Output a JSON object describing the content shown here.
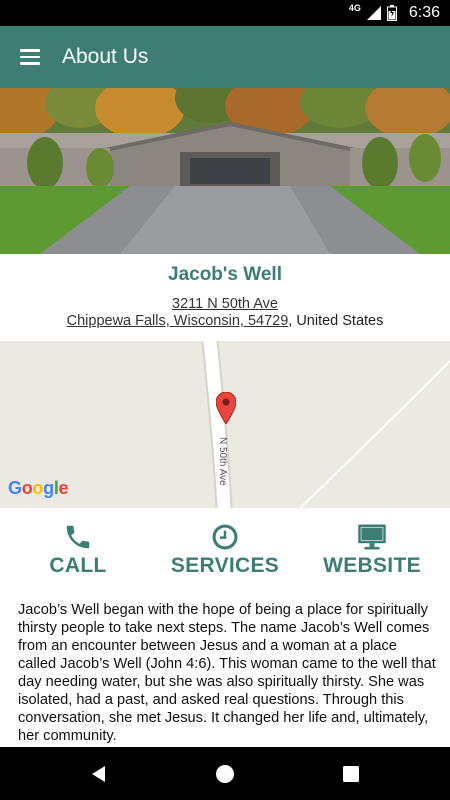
{
  "status_bar": {
    "network": "4G",
    "time": "6:36"
  },
  "app_bar": {
    "title": "About Us"
  },
  "organization": {
    "name": "Jacob's Well",
    "street": "3211 N 50th Ave",
    "city_state_zip": "Chippewa Falls, Wisconsin, 54729",
    "country_suffix": ", United States"
  },
  "map": {
    "road_label": "N 50th Ave",
    "attribution": [
      "G",
      "o",
      "o",
      "g",
      "l",
      "e"
    ]
  },
  "actions": [
    {
      "label": "CALL",
      "icon": "phone-icon"
    },
    {
      "label": "SERVICES",
      "icon": "clock-icon"
    },
    {
      "label": "WEBSITE",
      "icon": "monitor-icon"
    }
  ],
  "description": "Jacob’s Well began with the hope of being a place for spiritually thirsty people to take next steps. The name Jacob’s Well comes from an encounter between Jesus and a woman at a place called Jacob’s Well (John 4:6). This woman came to the well that day needing water, but she was also spiritually thirsty. She was isolated, had a past, and asked real questions. Through this conversation, she met Jesus. It changed her life and, ultimately, her community.",
  "colors": {
    "primary": "#3d7d73",
    "status_bar": "#000000",
    "map_bg": "#ece9e2"
  }
}
